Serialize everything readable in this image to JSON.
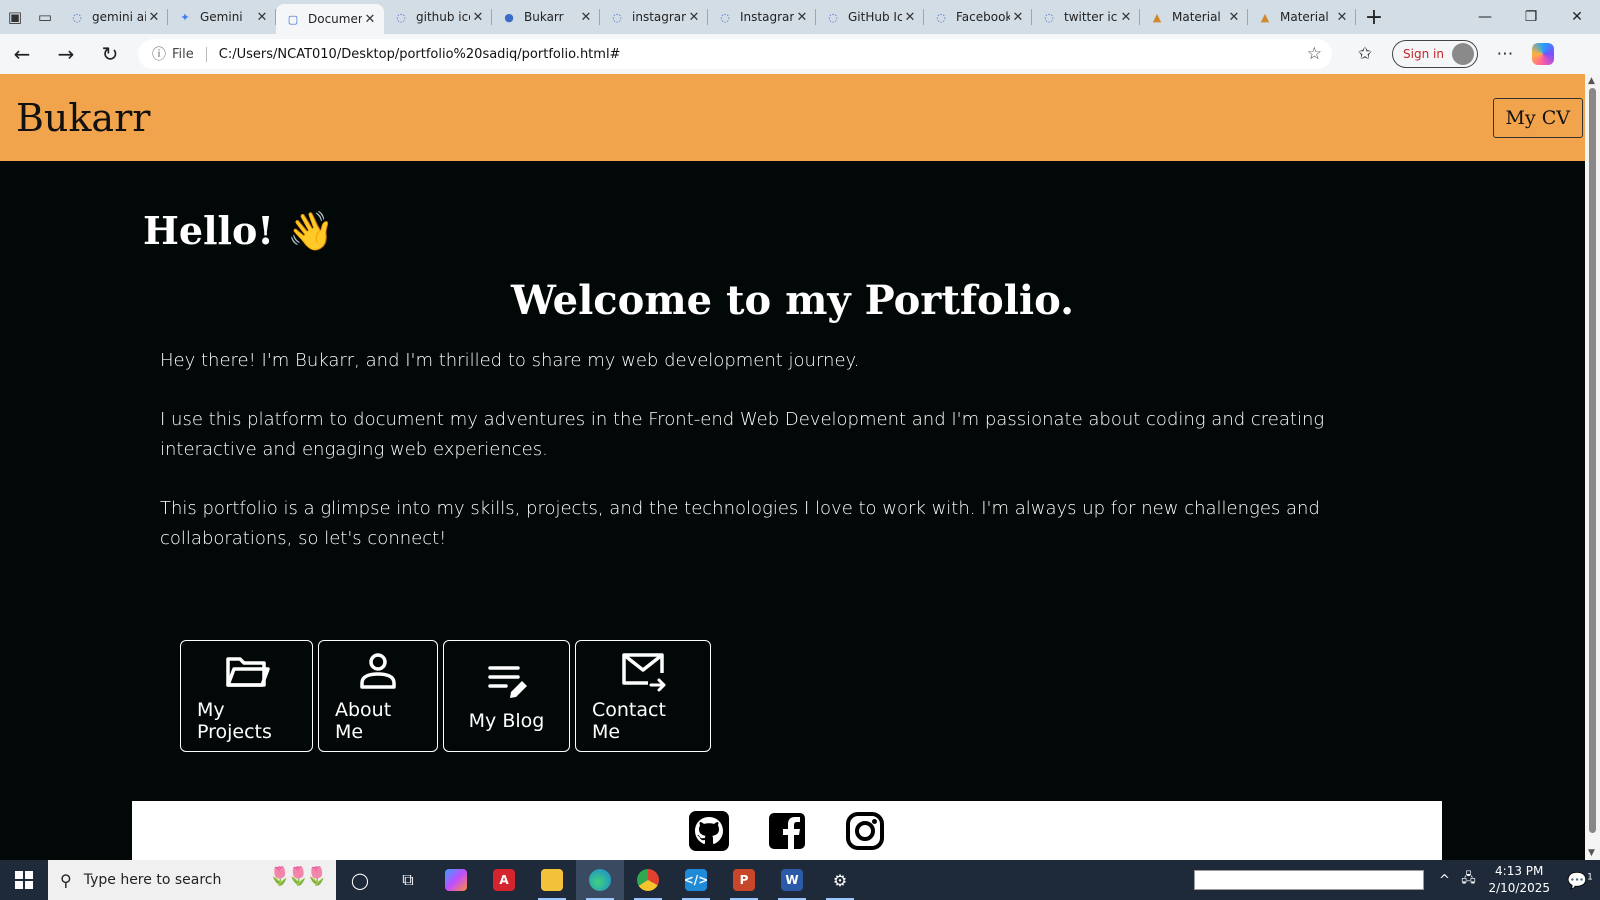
{
  "browser": {
    "tabs": [
      {
        "title": "gemini ai",
        "icon": "search-icon"
      },
      {
        "title": "Gemini",
        "icon": "gemini-icon"
      },
      {
        "title": "Document",
        "icon": "document-icon",
        "active": true
      },
      {
        "title": "github icon",
        "icon": "search-icon"
      },
      {
        "title": "Bukarr",
        "icon": "github-icon"
      },
      {
        "title": "instagram",
        "icon": "search-icon"
      },
      {
        "title": "Instagram",
        "icon": "search-icon"
      },
      {
        "title": "GitHub Icon",
        "icon": "search-icon"
      },
      {
        "title": "Facebook",
        "icon": "search-icon"
      },
      {
        "title": "twitter icon",
        "icon": "search-icon"
      },
      {
        "title": "Material",
        "icon": "material-icon"
      },
      {
        "title": "Material",
        "icon": "material-icon"
      }
    ],
    "file_label": "File",
    "url": "C:/Users/NCAT010/Desktop/portfolio%20sadiq/portfolio.html#",
    "sign_in_label": "Sign in"
  },
  "site": {
    "brand": "Bukarr",
    "cv_button": "My CV",
    "hello": "Hello! 👋",
    "welcome": "Welcome to my Portfolio.",
    "paragraphs": [
      "Hey there! I'm Bukarr, and I'm thrilled to share my web development journey.",
      "I use this platform to document my adventures in the Front-end Web Development and I'm passionate about coding and creating interactive and engaging web experiences.",
      "This portfolio is a glimpse into my skills, projects, and the technologies I love to work with. I'm always up for new challenges and collaborations, so let's connect!"
    ],
    "cards": [
      {
        "label": "My Projects",
        "icon": "folder-icon"
      },
      {
        "label": "About Me",
        "icon": "person-icon"
      },
      {
        "label": "My Blog",
        "icon": "blog-icon"
      },
      {
        "label": "Contact Me",
        "icon": "mail-icon"
      }
    ],
    "social": [
      "github-icon",
      "facebook-icon",
      "instagram-icon"
    ],
    "header_color": "#f2a44c",
    "background_color": "#020807"
  },
  "taskbar": {
    "search_placeholder": "Type here to search",
    "apps": [
      "cortana",
      "task-view",
      "copilot",
      "acrobat",
      "file-explorer",
      "edge",
      "chrome",
      "vscode",
      "powerpoint",
      "word",
      "settings"
    ],
    "time": "4:13 PM",
    "date": "2/10/2025",
    "notification_count": "1"
  }
}
